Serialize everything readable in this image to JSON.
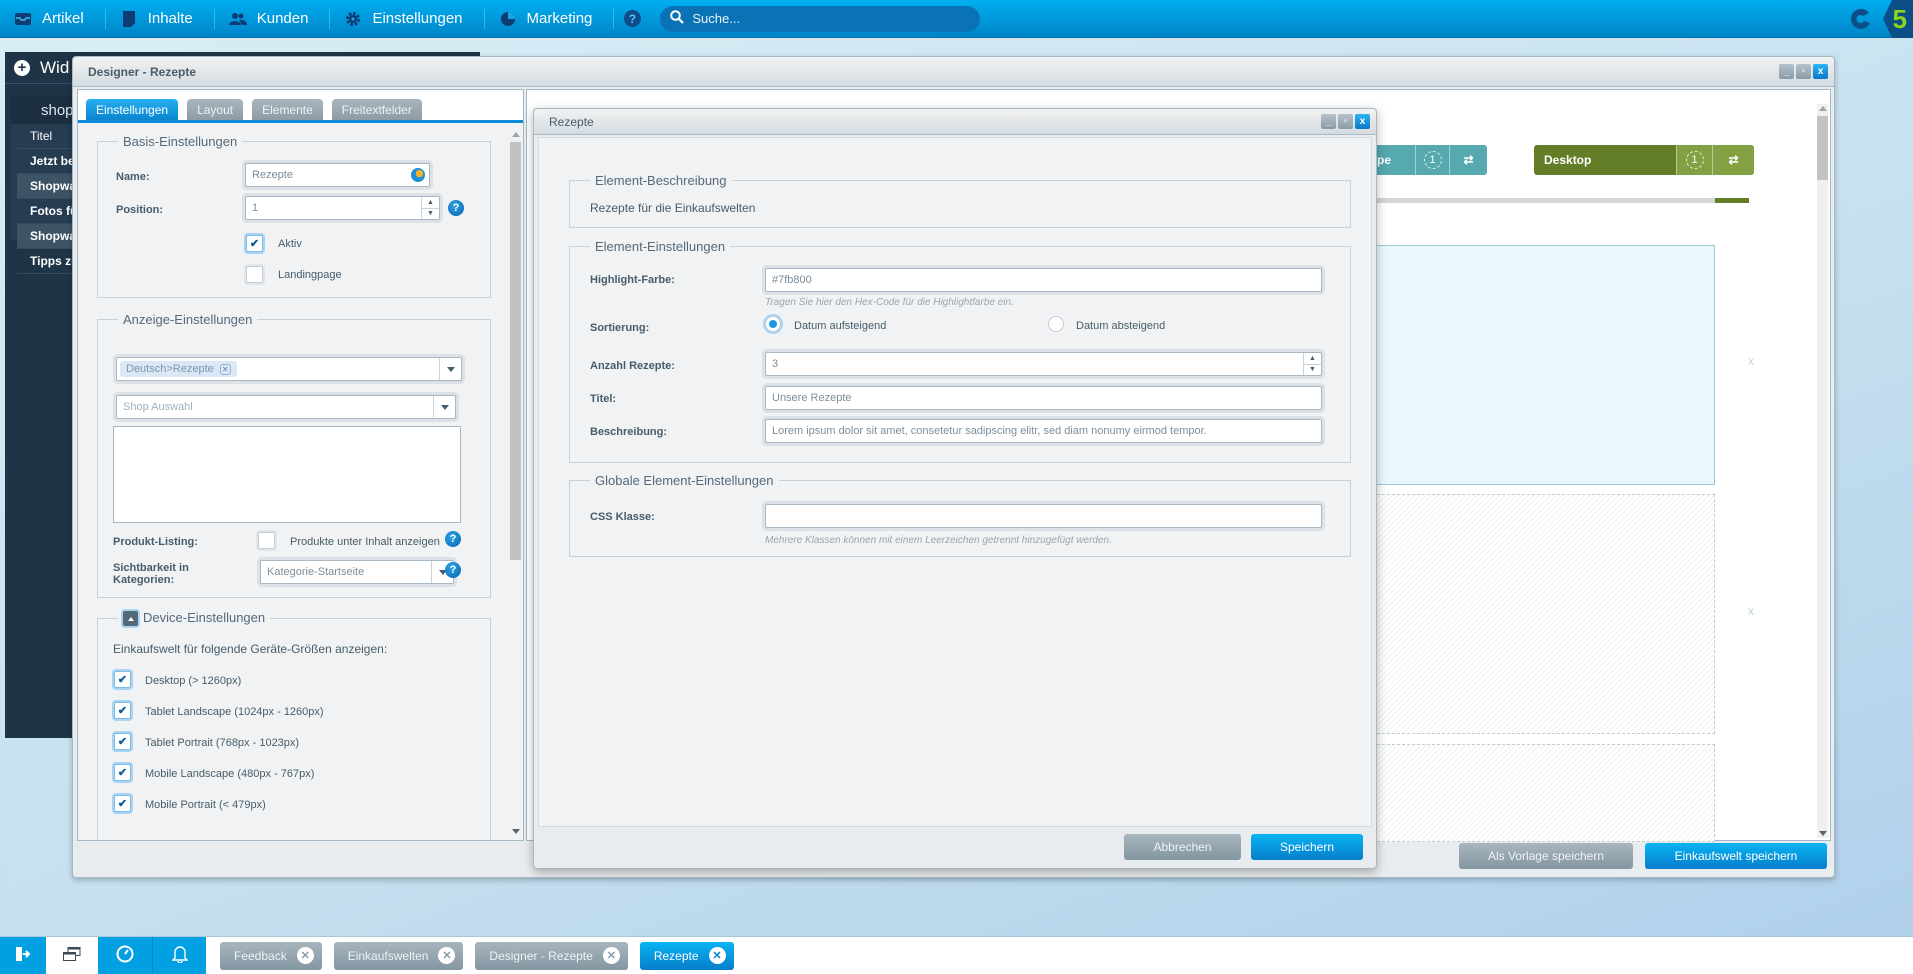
{
  "topbar": {
    "menu": [
      {
        "label": "Artikel",
        "icon": "inbox-icon"
      },
      {
        "label": "Inhalte",
        "icon": "document-icon"
      },
      {
        "label": "Kunden",
        "icon": "users-icon"
      },
      {
        "label": "Einstellungen",
        "icon": "gear-icon"
      },
      {
        "label": "Marketing",
        "icon": "pie-chart-icon"
      }
    ],
    "help_label": "?",
    "search_placeholder": "Suche...",
    "logo_text": "5"
  },
  "widget_panel": {
    "title": "Wid",
    "shop_label": "shopw",
    "items": [
      {
        "label": "Titel"
      },
      {
        "label": "Jetzt bew"
      },
      {
        "label": "Shopwar"
      },
      {
        "label": "Fotos für"
      },
      {
        "label": "Shopwar"
      },
      {
        "label": "Tipps zur"
      }
    ]
  },
  "designer": {
    "title": "Designer - Rezepte",
    "tabs": [
      {
        "label": "Einstellungen",
        "active": true
      },
      {
        "label": "Layout",
        "active": false
      },
      {
        "label": "Elemente",
        "active": false
      },
      {
        "label": "Freitextfelder",
        "active": false
      }
    ],
    "basis": {
      "legend": "Basis-Einstellungen",
      "name_label": "Name:",
      "name_value": "Rezepte",
      "position_label": "Position:",
      "position_value": "1",
      "aktiv_label": "Aktiv",
      "aktiv_checked": true,
      "landingpage_label": "Landingpage",
      "landingpage_checked": false
    },
    "anzeige": {
      "legend": "Anzeige-Einstellungen",
      "category_tag": "Deutsch>Rezepte",
      "shop_placeholder": "Shop Auswahl",
      "produkt_listing_label": "Produkt-Listing:",
      "produkt_listing_option": "Produkte unter Inhalt anzeigen",
      "produkt_listing_checked": false,
      "sichtbarkeit_label": "Sichtbarkeit in Kategorien:",
      "sichtbarkeit_value": "Kategorie-Startseite"
    },
    "device": {
      "legend": "Device-Einstellungen",
      "intro": "Einkaufswelt für folgende Geräte-Größen anzeigen:",
      "options": [
        {
          "label": "Desktop (> 1260px)",
          "checked": true
        },
        {
          "label": "Tablet Landscape (1024px - 1260px)",
          "checked": true
        },
        {
          "label": "Tablet Portrait (768px - 1023px)",
          "checked": true
        },
        {
          "label": "Mobile Landscape (480px - 767px)",
          "checked": true
        },
        {
          "label": "Mobile Portrait (< 479px)",
          "checked": true
        }
      ]
    },
    "canvas": {
      "devices": [
        {
          "name": "scape",
          "count": "1",
          "color": "#56a9ae"
        },
        {
          "name": "Desktop",
          "count": "1",
          "color": "#647d27"
        }
      ],
      "remove_label": "x"
    },
    "buttons": {
      "save_template": "Als Vorlage speichern",
      "save": "Einkaufswelt speichern"
    }
  },
  "element_window": {
    "title": "Rezepte",
    "beschreibung_legend": "Element-Beschreibung",
    "beschreibung_text": "Rezepte für die Einkaufswelten",
    "einstellungen_legend": "Element-Einstellungen",
    "highlight_label": "Highlight-Farbe:",
    "highlight_value": "#7fb800",
    "highlight_hint": "Tragen Sie hier den Hex-Code für die Highlightfarbe ein.",
    "sortierung_label": "Sortierung:",
    "sort_options": [
      {
        "label": "Datum aufsteigend",
        "selected": true
      },
      {
        "label": "Datum absteigend",
        "selected": false
      }
    ],
    "anzahl_label": "Anzahl Rezepte:",
    "anzahl_value": "3",
    "titel_label": "Titel:",
    "titel_value": "Unsere Rezepte",
    "beschreibung_label": "Beschreibung:",
    "beschreibung_value": "Lorem ipsum dolor sit amet, consetetur sadipscing elitr, sed diam nonumy eirmod tempor.",
    "global_legend": "Globale Element-Einstellungen",
    "css_label": "CSS Klasse:",
    "css_value": "",
    "css_hint": "Mehrere Klassen können mit einem Leerzeichen getrennt hinzugefügt werden.",
    "cancel_label": "Abbrechen",
    "save_label": "Speichern"
  },
  "taskbar": {
    "icons": [
      "logout-icon",
      "windows-icon",
      "dashboard-icon",
      "bell-icon"
    ],
    "tabs": [
      {
        "label": "Feedback",
        "active": false
      },
      {
        "label": "Einkaufswelten",
        "active": false
      },
      {
        "label": "Designer - Rezepte",
        "active": false
      },
      {
        "label": "Rezepte",
        "active": true
      }
    ]
  }
}
